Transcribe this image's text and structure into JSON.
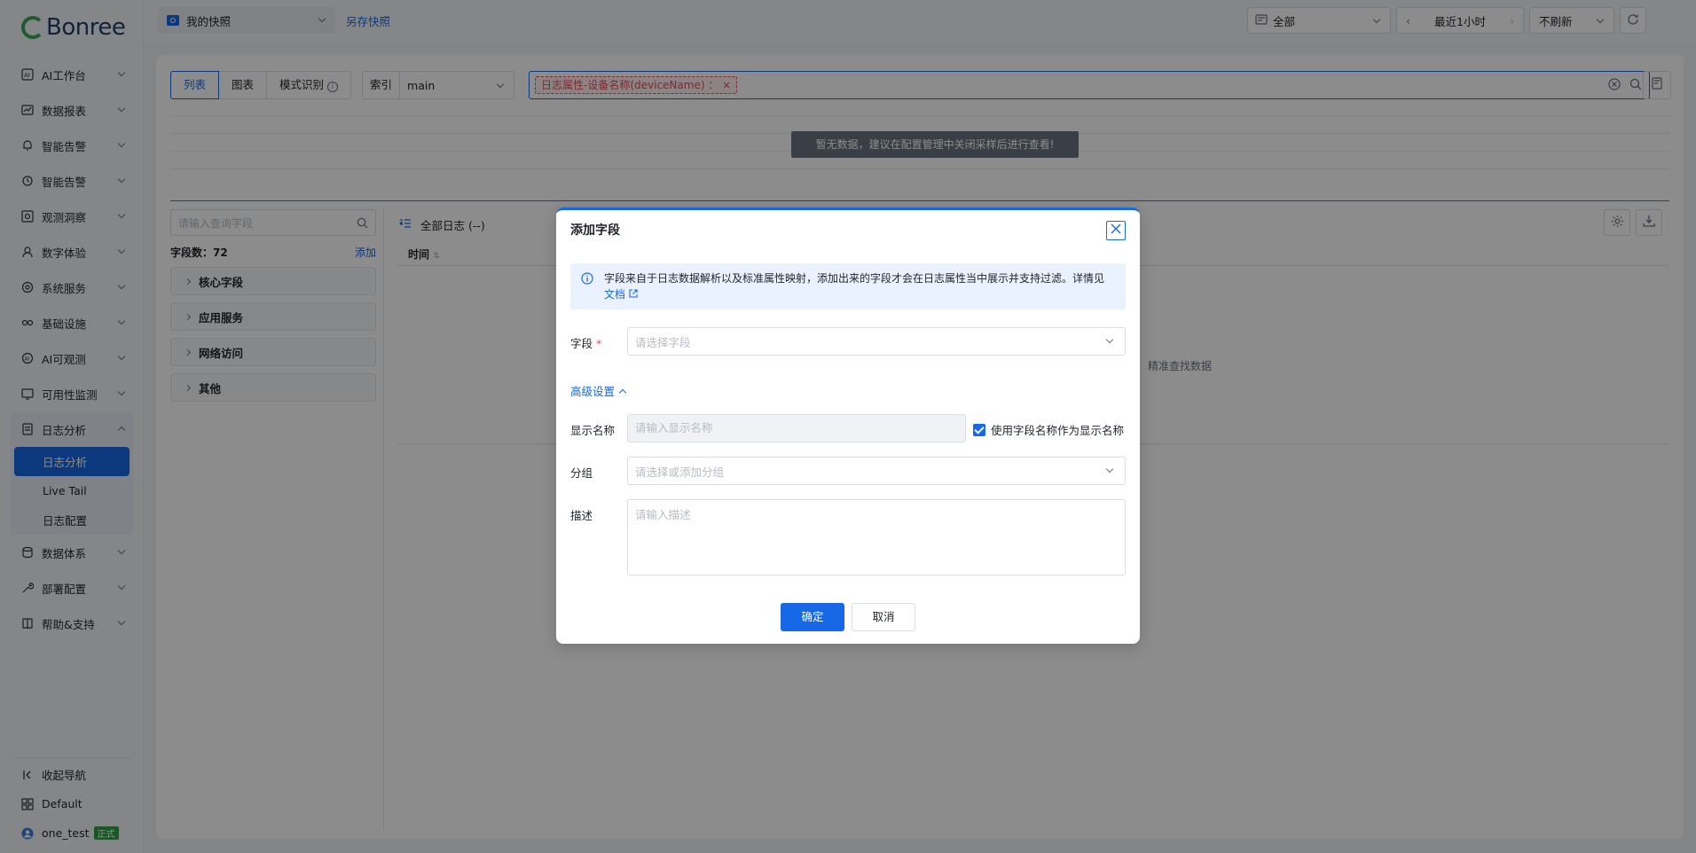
{
  "brand": {
    "logo_text": "Bonree"
  },
  "sidebar": {
    "items": [
      {
        "label": "AI工作台"
      },
      {
        "label": "数据报表"
      },
      {
        "label": "智能告警"
      },
      {
        "label": "智能告警"
      },
      {
        "label": "观测洞察"
      },
      {
        "label": "数字体验"
      },
      {
        "label": "系统服务"
      },
      {
        "label": "基础设施"
      },
      {
        "label": "AI可观测"
      },
      {
        "label": "可用性监测"
      }
    ],
    "log_group": {
      "label": "日志分析",
      "subs": [
        "日志分析",
        "Live Tail",
        "日志配置"
      ]
    },
    "items_after": [
      {
        "label": "数据体系"
      },
      {
        "label": "部署配置"
      },
      {
        "label": "帮助&支持"
      }
    ],
    "bottom": {
      "collapse": "收起导航",
      "workspace": "Default",
      "user": "one_test",
      "user_badge": "正式"
    }
  },
  "topbar": {
    "snapshot": "我的快照",
    "save_snapshot": "另存快照",
    "scope": "全部",
    "time_range": "最近1小时",
    "refresh": "不刷新"
  },
  "main": {
    "tabs": [
      "列表",
      "图表",
      "模式识别"
    ],
    "index_label": "索引",
    "index_value": "main",
    "query_tag": "日志属性-设备名称(deviceName) ：",
    "no_data_banner": "暂无数据，建议在配置管理中关闭采样后进行查看!",
    "field_search_placeholder": "请输入查询字段",
    "field_count_label": "字段数：",
    "field_count": "72",
    "add_label": "添加",
    "field_groups": [
      "核心字段",
      "应用服务",
      "网络访问",
      "其他"
    ],
    "log_title": "全部日志 (--)",
    "time_col": "时间",
    "empty_hint": "精准查找数据"
  },
  "modal": {
    "title": "添加字段",
    "info_text": "字段来自于日志数据解析以及标准属性映射，添加出来的字段才会在日志属性当中展示并支持过滤。详情见",
    "doc_link": "文档",
    "field_label": "字段",
    "field_placeholder": "请选择字段",
    "advanced": "高级设置",
    "display_label": "显示名称",
    "display_placeholder": "请输入显示名称",
    "use_field_name": "使用字段名称作为显示名称",
    "group_label": "分组",
    "group_placeholder": "请选择或添加分组",
    "desc_label": "描述",
    "desc_placeholder": "请输入描述",
    "ok": "确定",
    "cancel": "取消"
  },
  "colors": {
    "accent": "#1768e6",
    "overlay": "rgba(0,0,0,0.45)",
    "error": "#e34d59"
  }
}
